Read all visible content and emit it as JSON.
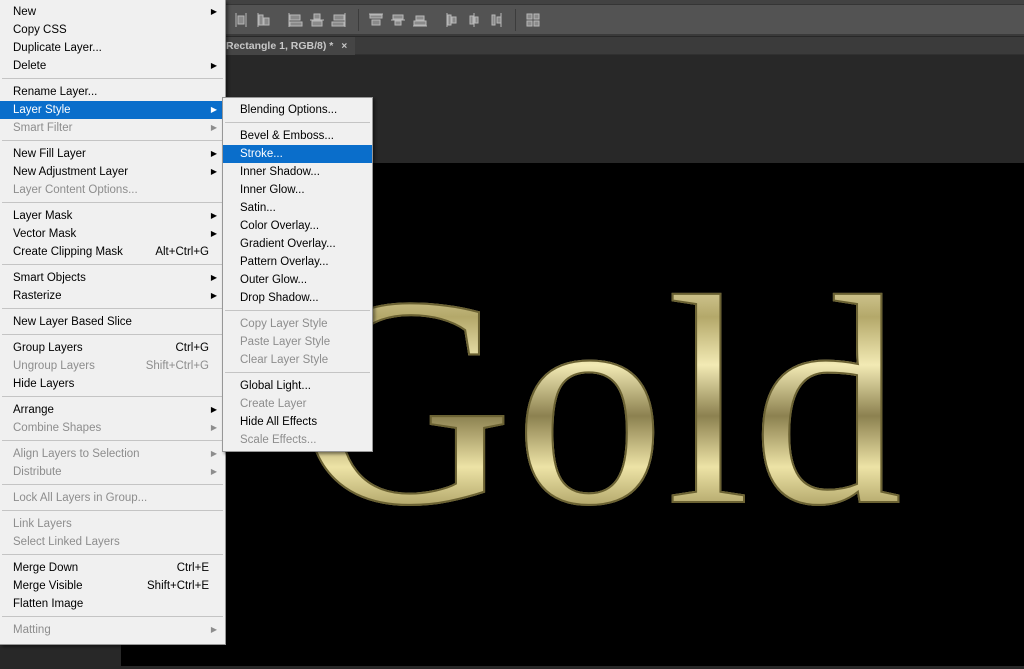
{
  "app": {
    "document_tab": {
      "title": "Rectangle 1, RGB/8) *",
      "close_glyph": "×"
    },
    "toolbar_icons": [
      "distribute-horizontal-centers-icon",
      "distribute-right-edges-icon",
      "align-top-edges-icon",
      "align-vertical-centers-icon",
      "align-bottom-edges-icon",
      "align-left-edges-icon",
      "align-horizontal-centers-icon",
      "align-right-edges-icon",
      "distribute-top-edges-icon",
      "distribute-vertical-centers-icon",
      "distribute-bottom-edges-icon",
      "auto-align-layers-icon"
    ],
    "canvas": {
      "text": "Gold",
      "background": "#000000",
      "text_style": "gold bevel"
    }
  },
  "layer_menu": {
    "groups": [
      [
        {
          "label": "New",
          "submenu": true,
          "enabled": true
        },
        {
          "label": "Copy CSS",
          "enabled": true
        },
        {
          "label": "Duplicate Layer...",
          "enabled": true
        },
        {
          "label": "Delete",
          "submenu": true,
          "enabled": true
        }
      ],
      [
        {
          "label": "Rename Layer...",
          "enabled": true
        },
        {
          "label": "Layer Style",
          "submenu": true,
          "enabled": true,
          "active": true
        },
        {
          "label": "Smart Filter",
          "submenu": true,
          "enabled": false
        }
      ],
      [
        {
          "label": "New Fill Layer",
          "submenu": true,
          "enabled": true
        },
        {
          "label": "New Adjustment Layer",
          "submenu": true,
          "enabled": true
        },
        {
          "label": "Layer Content Options...",
          "enabled": false
        }
      ],
      [
        {
          "label": "Layer Mask",
          "submenu": true,
          "enabled": true
        },
        {
          "label": "Vector Mask",
          "submenu": true,
          "enabled": true
        },
        {
          "label": "Create Clipping Mask",
          "shortcut": "Alt+Ctrl+G",
          "enabled": true
        }
      ],
      [
        {
          "label": "Smart Objects",
          "submenu": true,
          "enabled": true
        },
        {
          "label": "Rasterize",
          "submenu": true,
          "enabled": true
        }
      ],
      [
        {
          "label": "New Layer Based Slice",
          "enabled": true
        }
      ],
      [
        {
          "label": "Group Layers",
          "shortcut": "Ctrl+G",
          "enabled": true
        },
        {
          "label": "Ungroup Layers",
          "shortcut": "Shift+Ctrl+G",
          "enabled": false
        },
        {
          "label": "Hide Layers",
          "enabled": true
        }
      ],
      [
        {
          "label": "Arrange",
          "submenu": true,
          "enabled": true
        },
        {
          "label": "Combine Shapes",
          "submenu": true,
          "enabled": false
        }
      ],
      [
        {
          "label": "Align Layers to Selection",
          "submenu": true,
          "enabled": false
        },
        {
          "label": "Distribute",
          "submenu": true,
          "enabled": false
        }
      ],
      [
        {
          "label": "Lock All Layers in Group...",
          "enabled": false
        }
      ],
      [
        {
          "label": "Link Layers",
          "enabled": false
        },
        {
          "label": "Select Linked Layers",
          "enabled": false
        }
      ],
      [
        {
          "label": "Merge Down",
          "shortcut": "Ctrl+E",
          "enabled": true
        },
        {
          "label": "Merge Visible",
          "shortcut": "Shift+Ctrl+E",
          "enabled": true
        },
        {
          "label": "Flatten Image",
          "enabled": true
        }
      ],
      [
        {
          "label": "Matting",
          "submenu": true,
          "enabled": false
        }
      ]
    ]
  },
  "layer_style_submenu": {
    "groups": [
      [
        {
          "label": "Blending Options...",
          "enabled": true
        }
      ],
      [
        {
          "label": "Bevel & Emboss...",
          "enabled": true
        },
        {
          "label": "Stroke...",
          "enabled": true,
          "active": true
        },
        {
          "label": "Inner Shadow...",
          "enabled": true
        },
        {
          "label": "Inner Glow...",
          "enabled": true
        },
        {
          "label": "Satin...",
          "enabled": true
        },
        {
          "label": "Color Overlay...",
          "enabled": true
        },
        {
          "label": "Gradient Overlay...",
          "enabled": true
        },
        {
          "label": "Pattern Overlay...",
          "enabled": true
        },
        {
          "label": "Outer Glow...",
          "enabled": true
        },
        {
          "label": "Drop Shadow...",
          "enabled": true
        }
      ],
      [
        {
          "label": "Copy Layer Style",
          "enabled": false
        },
        {
          "label": "Paste Layer Style",
          "enabled": false
        },
        {
          "label": "Clear Layer Style",
          "enabled": false
        }
      ],
      [
        {
          "label": "Global Light...",
          "enabled": true
        },
        {
          "label": "Create Layer",
          "enabled": false
        },
        {
          "label": "Hide All Effects",
          "enabled": true
        },
        {
          "label": "Scale Effects...",
          "enabled": false
        }
      ]
    ]
  },
  "colors": {
    "menu_bg": "#f0f0f0",
    "highlight": "#0a6ecb",
    "disabled_text": "#8d8d8d",
    "options_bar": "#535353",
    "workspace": "#282828"
  },
  "glyphs": {
    "submenu_arrow": "▶"
  }
}
